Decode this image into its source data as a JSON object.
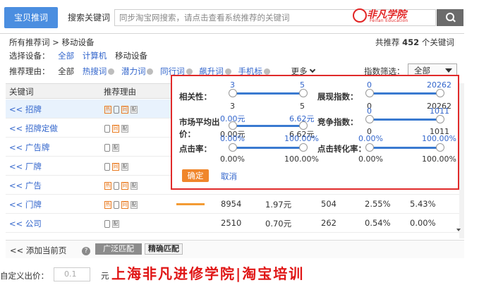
{
  "tabs": {
    "active": "宝贝推词",
    "other": "搜索关键词"
  },
  "search": {
    "placeholder": "同步淘宝网搜索，请点击查看系统推荐的关键词"
  },
  "logo": {
    "name": "非凡学院",
    "sub": "Feifan Education"
  },
  "breadcrumb": {
    "root": "所有推荐词",
    "sep": " > ",
    "current": "移动设备"
  },
  "total": {
    "prefix": "共推荐",
    "count": "452",
    "suffix": "个关键词"
  },
  "device_filter": {
    "label": "选择设备：",
    "options": [
      "全部",
      "计算机",
      "移动设备"
    ]
  },
  "reason_filter": {
    "label": "推荐理由：",
    "options": [
      "全部",
      "热搜词",
      "潜力词",
      "同行词",
      "飙升词",
      "手机标"
    ],
    "more": "更多"
  },
  "index_filter": {
    "label": "指数筛选：",
    "value": "全部"
  },
  "table": {
    "headers": [
      "关键词",
      "推荐理由"
    ],
    "rows": [
      {
        "keyword": "<< 招牌",
        "tags": [
          "hot",
          "mob",
          "same",
          "pc"
        ],
        "highlight": true
      },
      {
        "keyword": "<< 招牌定做",
        "tags": [
          "mob",
          "same",
          "pc"
        ]
      },
      {
        "keyword": "<< 广告牌",
        "tags": [
          "mob",
          "pc"
        ]
      },
      {
        "keyword": "<< 厂牌",
        "tags": [
          "mob",
          "same",
          "pc"
        ]
      },
      {
        "keyword": "<< 广告",
        "tags": [
          "hot",
          "mob",
          "same",
          "pc"
        ]
      },
      {
        "keyword": "<< 门牌",
        "tags": [
          "hot",
          "mob",
          "same",
          "pc"
        ],
        "impressions": "8954",
        "price": "1.97元",
        "competition": "504",
        "ctr": "2.55%",
        "cvr": "5.43%"
      },
      {
        "keyword": "<< 公司",
        "tags": [
          "mob",
          "pc"
        ],
        "impressions": "2510",
        "price": "0.70元",
        "competition": "262",
        "ctr": "0.54%",
        "cvr": "0.00%"
      }
    ]
  },
  "bottom": {
    "add_page": "<< 添加当前页",
    "help": "?",
    "broad": "广泛匹配",
    "exact": "精确匹配"
  },
  "custom_bid": {
    "label": "自定义出价：",
    "value": "0.1",
    "unit": "元"
  },
  "watermark": "上海非凡进修学院|淘宝培训",
  "popup": {
    "relevance": {
      "label": "相关性：",
      "min": "3",
      "max": "5",
      "min2": "3",
      "max2": "5"
    },
    "impressions": {
      "label": "展现指数：",
      "min": "0",
      "max": "20262",
      "min2": "0",
      "max2": "20262"
    },
    "avg_price": {
      "label1": "市场平均出",
      "label2": "价：",
      "min": "0.00元",
      "max": "6.62元",
      "min2": "0.00元",
      "max2": "6.62元"
    },
    "competition": {
      "label": "竞争指数：",
      "min": "0",
      "max": "1011",
      "min2": "0",
      "max2": "1011"
    },
    "ctr": {
      "label": "点击率：",
      "min": "0.00%",
      "max": "100.00%",
      "min2": "0.00%",
      "max2": "100.00%"
    },
    "cvr": {
      "label": "点击转化率：",
      "min": "0.00%",
      "max": "100.00%",
      "min2": "0.00%",
      "max2": "100.00%"
    },
    "ok": "确定",
    "cancel": "取消"
  },
  "colors": {
    "accent": "#4b8ee0",
    "popup_border": "#e02a2a",
    "ok_button": "#f0862b",
    "bar": "#f39b34"
  }
}
